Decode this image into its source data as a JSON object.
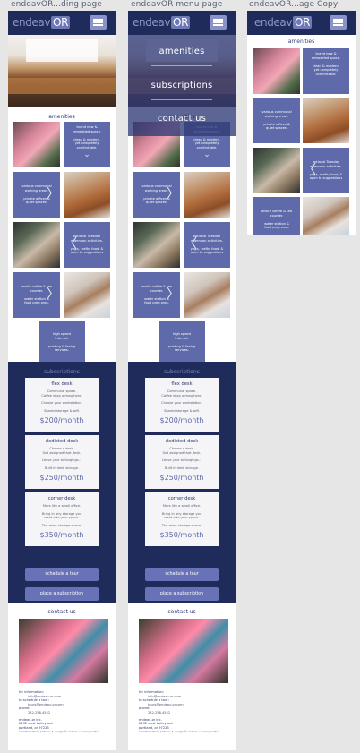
{
  "boards": [
    {
      "title": "endeavOR...ding page"
    },
    {
      "title": "endeavOR menu page"
    },
    {
      "title": "endeavOR...age Copy"
    }
  ],
  "logo": {
    "text": "endeav",
    "badge": "OR"
  },
  "amenities": {
    "title": "amenities",
    "cards": [
      {
        "lines": [
          "brand new &",
          "remodeled space."
        ],
        "lines2": [
          "clean & modern,",
          "yet completely",
          "comfortable."
        ]
      },
      {
        "lines": [
          "various communal",
          "working areas."
        ],
        "lines2": [
          "private offices &",
          "quiet spaces."
        ]
      },
      {
        "lines": [
          "optional Tuesday",
          "afternoon activities."
        ],
        "lines2": [
          "yoga, crafts, food, &",
          "open to suggestions"
        ]
      },
      {
        "lines": [
          "onsite coffee & tea",
          "counter."
        ],
        "lines2": [
          "water station &",
          "food prep area."
        ]
      },
      {
        "lines": [
          "high speed",
          "internet."
        ],
        "lines2": [
          "printing & faxing",
          "services."
        ]
      }
    ]
  },
  "subscriptions": {
    "title": "subscriptions",
    "plans": [
      {
        "name": "flex desk",
        "d1": [
          "Communal space.",
          "Coffee shop atmosphere."
        ],
        "d2": [
          "Choose your workstation."
        ],
        "d3": [
          "Shared storage & wifi."
        ],
        "price": "$200/month"
      },
      {
        "name": "dedicted desk",
        "d1": [
          "Choose a desk.",
          "Get assigned that desk."
        ],
        "d2": [
          "Leave your belongings..."
        ],
        "d3": [
          "Built in desk storage."
        ],
        "price": "$250/month"
      },
      {
        "name": "corner desk",
        "d1": [
          "More like a small office."
        ],
        "d2": [
          "Bring in any storage you",
          "want into your space."
        ],
        "d3": [
          "The most storage space."
        ],
        "price": "$350/month"
      }
    ],
    "buttons": {
      "tour": "schedule a tour",
      "place": "place a subscription"
    }
  },
  "contact": {
    "title": "contact us",
    "info_label": "for information:",
    "info_email": "info@endeav-or.com",
    "tour_label": "to schedule a tour:",
    "tour_email": "tours@endeav-or.com",
    "phone_label": "phone:",
    "phone": "232.258.4552",
    "company": "endeav-or inc.",
    "street": "2132 west bailey ave",
    "city": "portland, or 97223",
    "footer": "all information, pictures & design © endeav-or incorporated"
  },
  "menu": {
    "items": [
      "amenities",
      "subscriptions",
      "contact us"
    ]
  },
  "colors": {
    "navy": "#1f2b5b",
    "accent": "#5f6aaa",
    "button": "#6872b7"
  }
}
